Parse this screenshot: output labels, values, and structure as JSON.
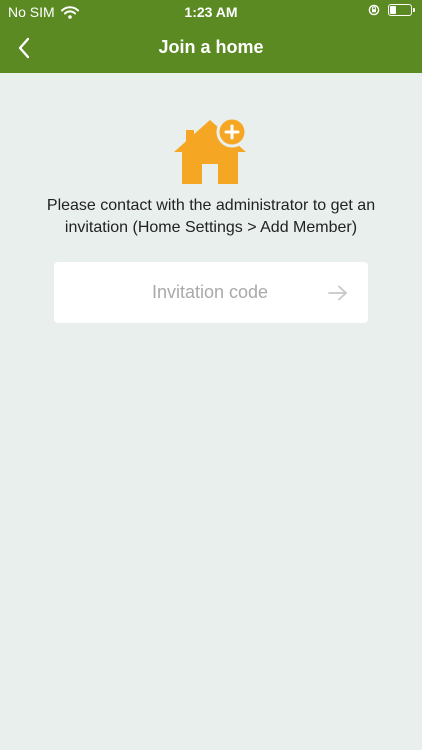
{
  "status_bar": {
    "carrier": "No SIM",
    "time": "1:23 AM",
    "battery_level": 0.25
  },
  "nav": {
    "title": "Join a home"
  },
  "main": {
    "instruction": "Please contact with the administrator to get an invitation (Home Settings > Add Member)",
    "invitation_input": {
      "placeholder": "Invitation code",
      "value": ""
    }
  },
  "icons": {
    "back": "chevron-left-icon",
    "home": "home-add-icon",
    "submit": "arrow-right-icon",
    "wifi": "wifi-icon",
    "orientation_lock": "orientation-lock-icon",
    "battery": "battery-icon"
  },
  "colors": {
    "header_green": "#5b8a23",
    "background": "#e9efec",
    "home_orange": "#f5a623",
    "placeholder_gray": "#a9a9a9",
    "arrow_gray": "#c8c8c8"
  }
}
